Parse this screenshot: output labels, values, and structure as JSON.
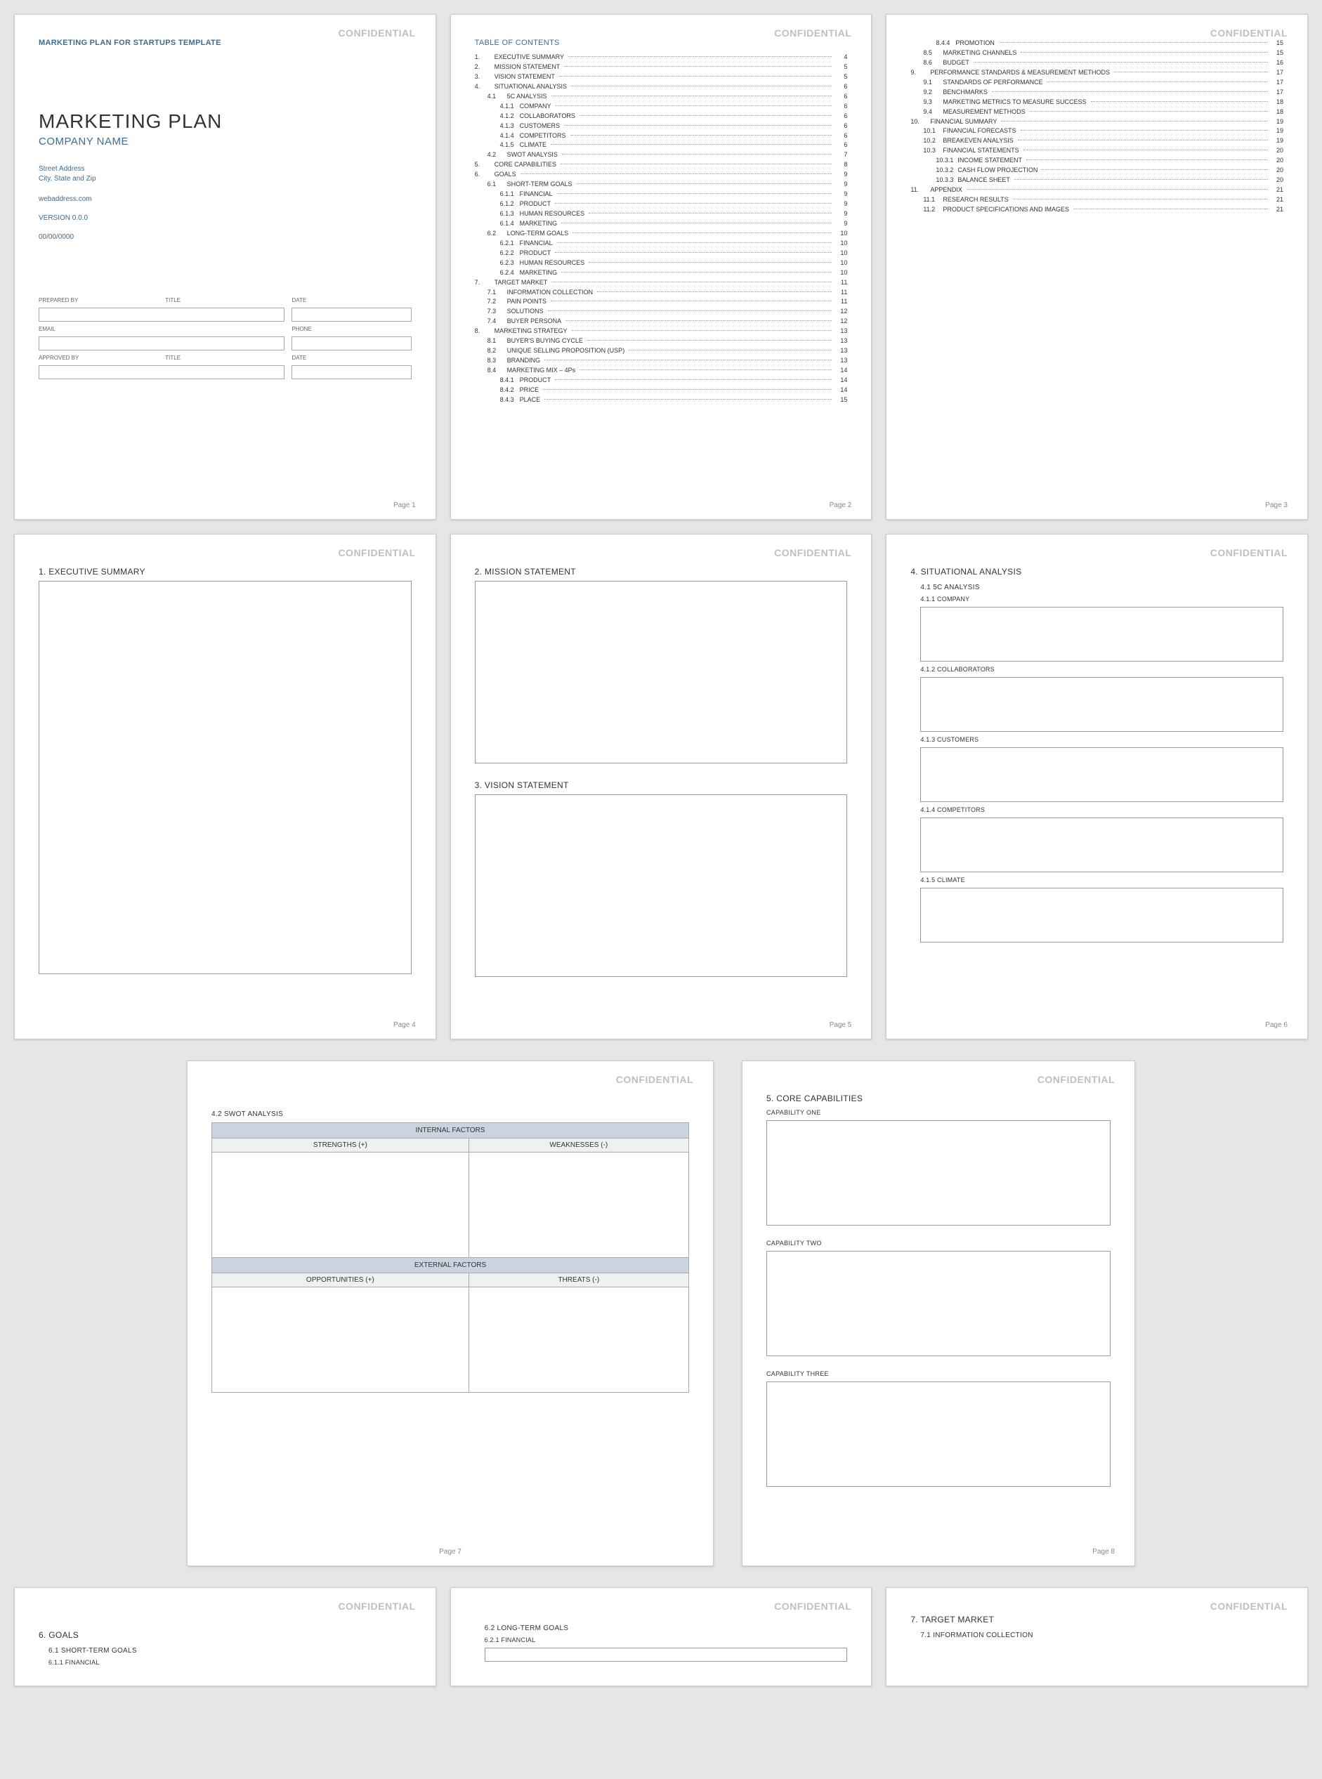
{
  "confidential": "CONFIDENTIAL",
  "p1": {
    "templateTitle": "MARKETING PLAN FOR STARTUPS TEMPLATE",
    "mainTitle": "MARKETING PLAN",
    "companyName": "COMPANY NAME",
    "address1": "Street Address",
    "address2": "City, State and Zip",
    "web": "webaddress.com",
    "version": "VERSION 0.0.0",
    "date": "00/00/0000",
    "labels": {
      "preparedBy": "PREPARED BY",
      "title": "TITLE",
      "dateL": "DATE",
      "email": "EMAIL",
      "phone": "PHONE",
      "approvedBy": "APPROVED BY"
    },
    "pageNum": "Page 1"
  },
  "p2": {
    "title": "TABLE OF CONTENTS",
    "items": [
      {
        "n": "1.",
        "t": "EXECUTIVE SUMMARY",
        "p": "4",
        "l": 1
      },
      {
        "n": "2.",
        "t": "MISSION STATEMENT",
        "p": "5",
        "l": 1
      },
      {
        "n": "3.",
        "t": "VISION STATEMENT",
        "p": "5",
        "l": 1
      },
      {
        "n": "4.",
        "t": "SITUATIONAL ANALYSIS",
        "p": "6",
        "l": 1
      },
      {
        "n": "4.1",
        "t": "5C ANALYSIS",
        "p": "6",
        "l": 2
      },
      {
        "n": "4.1.1",
        "t": "COMPANY",
        "p": "6",
        "l": 3
      },
      {
        "n": "4.1.2",
        "t": "COLLABORATORS",
        "p": "6",
        "l": 3
      },
      {
        "n": "4.1.3",
        "t": "CUSTOMERS",
        "p": "6",
        "l": 3
      },
      {
        "n": "4.1.4",
        "t": "COMPETITORS",
        "p": "6",
        "l": 3
      },
      {
        "n": "4.1.5",
        "t": "CLIMATE",
        "p": "6",
        "l": 3
      },
      {
        "n": "4.2",
        "t": "SWOT ANALYSIS",
        "p": "7",
        "l": 2
      },
      {
        "n": "5.",
        "t": "CORE CAPABILITIES",
        "p": "8",
        "l": 1
      },
      {
        "n": "6.",
        "t": "GOALS",
        "p": "9",
        "l": 1
      },
      {
        "n": "6.1",
        "t": "SHORT-TERM GOALS",
        "p": "9",
        "l": 2
      },
      {
        "n": "6.1.1",
        "t": "FINANCIAL",
        "p": "9",
        "l": 3
      },
      {
        "n": "6.1.2",
        "t": "PRODUCT",
        "p": "9",
        "l": 3
      },
      {
        "n": "6.1.3",
        "t": "HUMAN RESOURCES",
        "p": "9",
        "l": 3
      },
      {
        "n": "6.1.4",
        "t": "MARKETING",
        "p": "9",
        "l": 3
      },
      {
        "n": "6.2",
        "t": "LONG-TERM GOALS",
        "p": "10",
        "l": 2
      },
      {
        "n": "6.2.1",
        "t": "FINANCIAL",
        "p": "10",
        "l": 3
      },
      {
        "n": "6.2.2",
        "t": "PRODUCT",
        "p": "10",
        "l": 3
      },
      {
        "n": "6.2.3",
        "t": "HUMAN RESOURCES",
        "p": "10",
        "l": 3
      },
      {
        "n": "6.2.4",
        "t": "MARKETING",
        "p": "10",
        "l": 3
      },
      {
        "n": "7.",
        "t": "TARGET MARKET",
        "p": "11",
        "l": 1
      },
      {
        "n": "7.1",
        "t": "INFORMATION COLLECTION",
        "p": "11",
        "l": 2
      },
      {
        "n": "7.2",
        "t": "PAIN POINTS",
        "p": "11",
        "l": 2
      },
      {
        "n": "7.3",
        "t": "SOLUTIONS",
        "p": "12",
        "l": 2
      },
      {
        "n": "7.4",
        "t": "BUYER PERSONA",
        "p": "12",
        "l": 2
      },
      {
        "n": "8.",
        "t": "MARKETING STRATEGY",
        "p": "13",
        "l": 1
      },
      {
        "n": "8.1",
        "t": "BUYER'S BUYING CYCLE",
        "p": "13",
        "l": 2
      },
      {
        "n": "8.2",
        "t": "UNIQUE SELLING PROPOSITION (USP)",
        "p": "13",
        "l": 2
      },
      {
        "n": "8.3",
        "t": "BRANDING",
        "p": "13",
        "l": 2
      },
      {
        "n": "8.4",
        "t": "MARKETING MIX – 4Ps",
        "p": "14",
        "l": 2
      },
      {
        "n": "8.4.1",
        "t": "PRODUCT",
        "p": "14",
        "l": 3
      },
      {
        "n": "8.4.2",
        "t": "PRICE",
        "p": "14",
        "l": 3
      },
      {
        "n": "8.4.3",
        "t": "PLACE",
        "p": "15",
        "l": 3
      }
    ],
    "pageNum": "Page 2"
  },
  "p3": {
    "items": [
      {
        "n": "8.4.4",
        "t": "PROMOTION",
        "p": "15",
        "l": 3
      },
      {
        "n": "8.5",
        "t": "MARKETING CHANNELS",
        "p": "15",
        "l": 2
      },
      {
        "n": "8.6",
        "t": "BUDGET",
        "p": "16",
        "l": 2
      },
      {
        "n": "9.",
        "t": "PERFORMANCE STANDARDS & MEASUREMENT METHODS",
        "p": "17",
        "l": 1
      },
      {
        "n": "9.1",
        "t": "STANDARDS OF PERFORMANCE",
        "p": "17",
        "l": 2
      },
      {
        "n": "9.2",
        "t": "BENCHMARKS",
        "p": "17",
        "l": 2
      },
      {
        "n": "9.3",
        "t": "MARKETING METRICS TO MEASURE SUCCESS",
        "p": "18",
        "l": 2
      },
      {
        "n": "9.4",
        "t": "MEASUREMENT METHODS",
        "p": "18",
        "l": 2
      },
      {
        "n": "10.",
        "t": "FINANCIAL SUMMARY",
        "p": "19",
        "l": 1
      },
      {
        "n": "10.1",
        "t": "FINANCIAL FORECASTS",
        "p": "19",
        "l": 2
      },
      {
        "n": "10.2",
        "t": "BREAKEVEN ANALYSIS",
        "p": "19",
        "l": 2
      },
      {
        "n": "10.3",
        "t": "FINANCIAL STATEMENTS",
        "p": "20",
        "l": 2
      },
      {
        "n": "10.3.1",
        "t": "INCOME STATEMENT",
        "p": "20",
        "l": 3
      },
      {
        "n": "10.3.2",
        "t": "CASH FLOW PROJECTION",
        "p": "20",
        "l": 3
      },
      {
        "n": "10.3.3",
        "t": "BALANCE SHEET",
        "p": "20",
        "l": 3
      },
      {
        "n": "11.",
        "t": "APPENDIX",
        "p": "21",
        "l": 1
      },
      {
        "n": "11.1",
        "t": "RESEARCH RESULTS",
        "p": "21",
        "l": 2
      },
      {
        "n": "11.2",
        "t": "PRODUCT SPECIFICATIONS AND IMAGES",
        "p": "21",
        "l": 2
      }
    ],
    "pageNum": "Page 3"
  },
  "p4": {
    "h": "1.  EXECUTIVE SUMMARY",
    "pageNum": "Page 4"
  },
  "p5": {
    "h1": "2.  MISSION STATEMENT",
    "h2": "3.  VISION STATEMENT",
    "pageNum": "Page 5"
  },
  "p6": {
    "h": "4.  SITUATIONAL ANALYSIS",
    "sub": "4.1   5C ANALYSIS",
    "items": [
      {
        "n": "4.1.1",
        "t": "COMPANY"
      },
      {
        "n": "4.1.2",
        "t": "COLLABORATORS"
      },
      {
        "n": "4.1.3",
        "t": "CUSTOMERS"
      },
      {
        "n": "4.1.4",
        "t": "COMPETITORS"
      },
      {
        "n": "4.1.5",
        "t": "CLIMATE"
      }
    ],
    "pageNum": "Page 6"
  },
  "p7": {
    "sub": "4.2   SWOT ANALYSIS",
    "internalFactors": "INTERNAL FACTORS",
    "strengths": "STRENGTHS (+)",
    "weaknesses": "WEAKNESSES (-)",
    "externalFactors": "EXTERNAL FACTORS",
    "opportunities": "OPPORTUNITIES (+)",
    "threats": "THREATS (-)",
    "pageNum": "Page 7"
  },
  "p8": {
    "h": "5.  CORE CAPABILITIES",
    "c1": "CAPABILITY ONE",
    "c2": "CAPABILITY TWO",
    "c3": "CAPABILITY THREE",
    "pageNum": "Page 8"
  },
  "p9": {
    "h": "6.  GOALS",
    "sub": "6.1   SHORT-TERM GOALS",
    "sub2": "6.1.1   FINANCIAL"
  },
  "p10": {
    "sub": "6.2   LONG-TERM GOALS",
    "sub2": "6.2.1   FINANCIAL"
  },
  "p11": {
    "h": "7.  TARGET MARKET",
    "sub": "7.1   INFORMATION COLLECTION"
  }
}
